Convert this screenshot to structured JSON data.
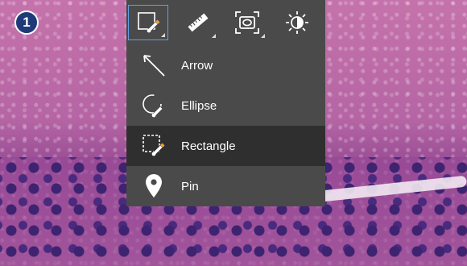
{
  "step": {
    "number": "1"
  },
  "toolbar": {
    "tools": [
      {
        "icon": "rectangle-annotation-icon",
        "active": true
      },
      {
        "icon": "ruler-icon",
        "active": false
      },
      {
        "icon": "region-capture-icon",
        "active": false
      },
      {
        "icon": "brightness-icon",
        "active": false
      }
    ]
  },
  "annotation_menu": {
    "items": [
      {
        "label": "Arrow",
        "icon": "arrow-icon"
      },
      {
        "label": "Ellipse",
        "icon": "ellipse-icon"
      },
      {
        "label": "Rectangle",
        "icon": "rectangle-icon",
        "selected": true
      },
      {
        "label": "Pin",
        "icon": "pin-icon"
      }
    ]
  },
  "colors": {
    "toolbar_bg": "#4a4a4a",
    "selected_item_bg": "#2f2f2f",
    "active_tool_border": "#5fa0e0",
    "badge_bg": "#1e3a78",
    "pen_accent": "#e8a23a"
  }
}
